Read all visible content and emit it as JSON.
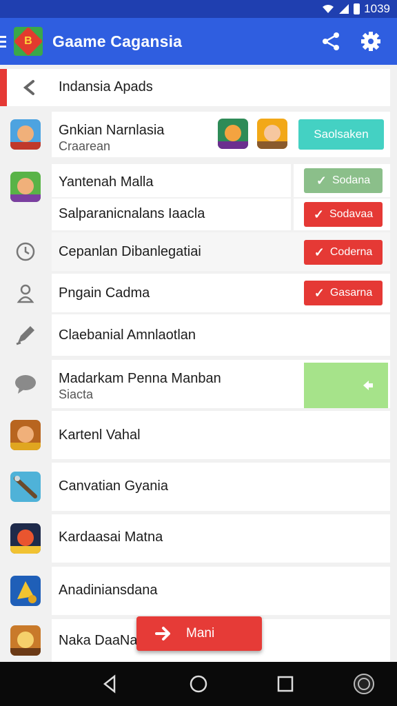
{
  "status_bar": {
    "time": "1039",
    "icons": [
      "wifi-icon",
      "signal-icon",
      "battery-icon"
    ]
  },
  "app_bar": {
    "title": "Gaame Cagansia",
    "icons": [
      "menu-icon",
      "app-logo",
      "share-icon",
      "settings-icon"
    ],
    "color": "#2f5ee0"
  },
  "header_row": {
    "label": "Indansia Apads",
    "icon": "back-arrow-icon",
    "accent": "#e53935"
  },
  "rows": [
    {
      "title": "Gnkian Narnlasia",
      "subtitle": "Craarean",
      "icon": "game-avatar-icon",
      "button": "Saolsaken",
      "button_color": "#44d1c3"
    },
    {
      "title": "Yantenah Malla",
      "icon": "game-avatar-icon",
      "button": "Sodana",
      "button_color": "#8bbf8a"
    },
    {
      "title": "Salparanicnalans Iaacla",
      "button": "Sodavaa",
      "button_color": "#e53935"
    },
    {
      "title": "Cepanlan Dibanlegatiai",
      "icon": "clock-icon",
      "button": "Coderna",
      "button_color": "#e53935"
    },
    {
      "title": "Pngain Cadma",
      "icon": "person-icon",
      "button": "Gasarna",
      "button_color": "#e53935"
    },
    {
      "title": "Claebanial Amnlaotlan",
      "icon": "pen-icon"
    },
    {
      "title": "Madarkam Penna Manban",
      "subtitle": "Siacta",
      "icon": "chat-bubble-icon",
      "panel_color": "#a6e38a"
    },
    {
      "title": "Kartenl Vahal",
      "icon": "game-avatar-icon"
    },
    {
      "title": "Canvatian Gyania",
      "icon": "game-tool-icon"
    },
    {
      "title": "Kardaasai Matna",
      "icon": "game-pirate-icon"
    },
    {
      "title": "Anadiniansdana",
      "icon": "game-gold-icon"
    },
    {
      "title": "Naka DaaNa",
      "icon": "game-logo-icon"
    }
  ],
  "fab": {
    "label": "Mani",
    "icon": "forward-arrow-icon",
    "color": "#e63b37"
  },
  "nav_bar": {
    "icons": [
      "nav-back-icon",
      "nav-home-icon",
      "nav-recents-icon",
      "nav-assistant-icon"
    ]
  }
}
